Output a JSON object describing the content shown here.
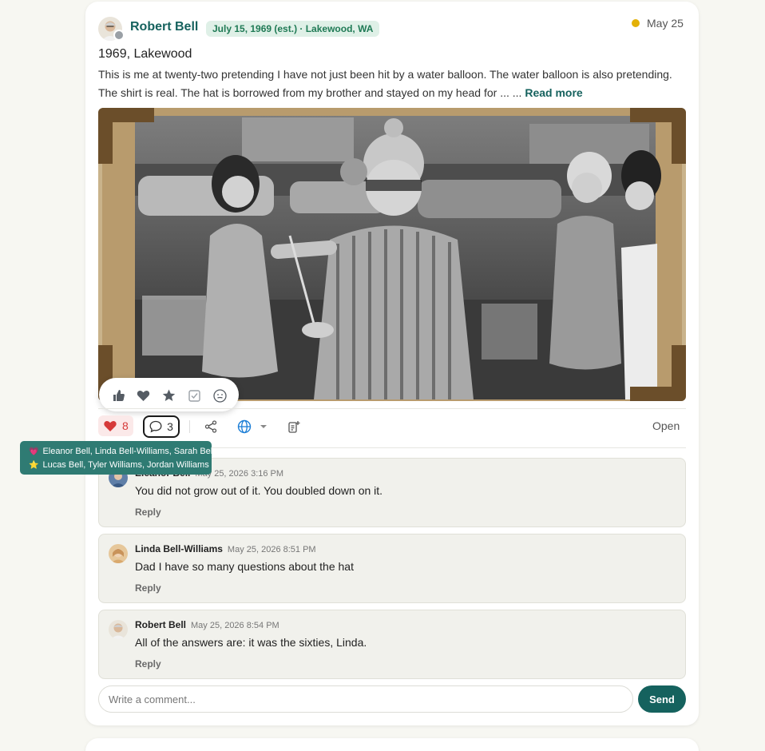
{
  "post": {
    "author": "Robert Bell",
    "date_chip": "July 15, 1969 (est.) · Lakewood, WA",
    "posted": "May 25",
    "title": "1969, Lakewood",
    "body": "This is me at twenty-two pretending I have not just been hit by a water balloon. The water balloon is also pretending. The shirt is real. The hat is borrowed from my brother and stayed on my head for ...",
    "ellipsis": " ...",
    "read_more": "Read more",
    "photo_alt": "Black-and-white photo of a man in a striped shirt and knit hat holding a ladle at a backyard party"
  },
  "reactions": {
    "icons": [
      "thumbs-up-icon",
      "heart-icon",
      "star-icon",
      "check-square-icon",
      "smile-icon"
    ]
  },
  "toolbar": {
    "likes": "8",
    "comments": "3",
    "open": "Open"
  },
  "tooltip": {
    "line1": "Eleanor Bell, Linda Bell-Williams, Sarah Bell",
    "line2": "Lucas Bell, Tyler Williams, Jordan Williams",
    "emoji1": "💗",
    "emoji2": "⭐"
  },
  "comments": [
    {
      "name": "Eleanor Bell",
      "time": "May 25, 2026 3:16 PM",
      "text": "You did not grow out of it. You doubled down on it.",
      "reply": "Reply"
    },
    {
      "name": "Linda Bell-Williams",
      "time": "May 25, 2026 8:51 PM",
      "text": "Dad I have so many questions about the hat",
      "reply": "Reply"
    },
    {
      "name": "Robert Bell",
      "time": "May 25, 2026 8:54 PM",
      "text": "All of the answers are: it was the sixties, Linda.",
      "reply": "Reply"
    }
  ],
  "composer": {
    "placeholder": "Write a comment...",
    "send": "Send"
  },
  "colors": {
    "brand": "#15625e",
    "like": "#d63a3a",
    "status": "#e3b107"
  }
}
